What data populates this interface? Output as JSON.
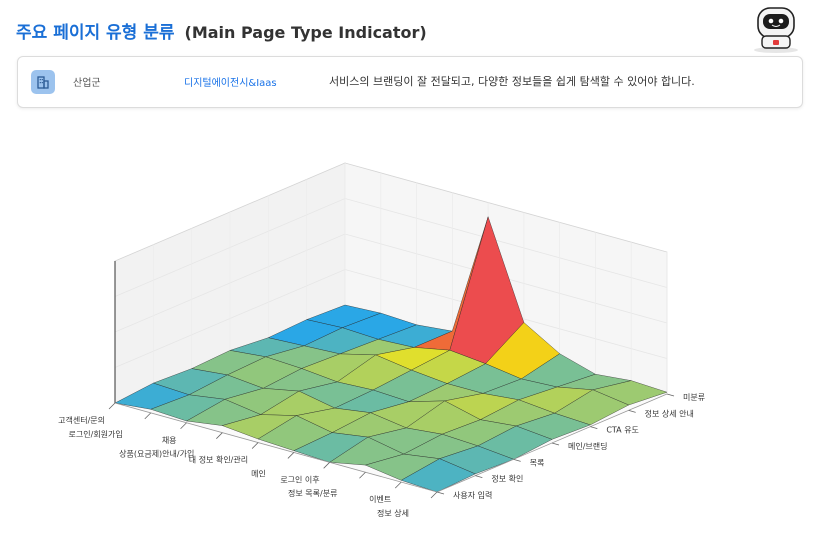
{
  "header": {
    "title_ko": "주요 페이지 유형 분류",
    "title_en": "(Main Page Type Indicator)"
  },
  "info": {
    "icon": "building-icon",
    "label": "산업군",
    "value": "디지털에이전시&Iaas",
    "description": "서비스의 브랜딩이 잘 전달되고, 다양한 정보들을 쉽게 탐색할 수 있어야 합니다."
  },
  "chart_data": {
    "type": "surface3d",
    "x": [
      "정보 상세",
      "이벤트",
      "정보 목록/분류",
      "로그인 이후",
      "메인",
      "내 정보 확인/관리",
      "상품(요금제)안내/가입",
      "채용",
      "로그인/회원가입",
      "고객센터/문의"
    ],
    "y": [
      "미분류",
      "정보 상세 안내",
      "CTA 유도",
      "메인/브랜딩",
      "목록",
      "정보 확인",
      "사용자 입력"
    ],
    "z": [
      [
        0.05,
        0.15,
        0.05,
        0.1,
        0.0,
        0.05,
        0.0
      ],
      [
        0.1,
        0.3,
        0.1,
        0.2,
        0.1,
        0.2,
        0.05
      ],
      [
        0.0,
        0.1,
        0.2,
        0.1,
        0.15,
        0.05,
        0.2
      ],
      [
        0.3,
        0.05,
        0.1,
        0.35,
        0.05,
        0.25,
        0.0
      ],
      [
        0.9,
        0.2,
        0.1,
        0.05,
        0.2,
        0.1,
        0.05
      ],
      [
        3.6,
        0.3,
        0.2,
        0.1,
        0.05,
        0.3,
        0.1
      ],
      [
        0.1,
        0.1,
        0.35,
        0.05,
        0.25,
        0.05,
        0.2
      ],
      [
        0.0,
        0.05,
        0.1,
        0.15,
        0.05,
        0.2,
        0.05
      ],
      [
        0.05,
        0.1,
        0.05,
        0.2,
        0.15,
        0.05,
        0.1
      ],
      [
        0.0,
        0.05,
        0.0,
        0.1,
        0.05,
        0.1,
        0.0
      ]
    ],
    "zlim": [
      0,
      4
    ],
    "colormap": [
      "#1b64d6",
      "#2aa8e6",
      "#f2e41a",
      "#f5a012",
      "#ea3b5a",
      "#ff0a7c"
    ],
    "grid": true
  }
}
